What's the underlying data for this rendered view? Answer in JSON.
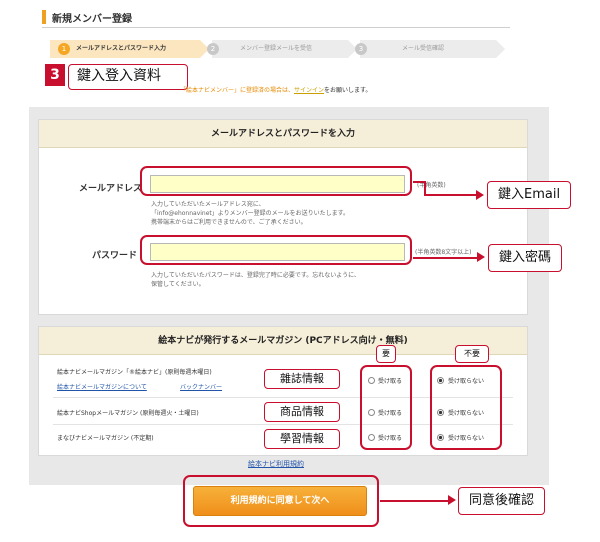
{
  "page": {
    "section_title": "新規メンバー登録"
  },
  "steps": [
    {
      "num": "1",
      "label": "メールアドレスとパスワード入力"
    },
    {
      "num": "2",
      "label": "メンバー登録メールを受信"
    },
    {
      "num": "3",
      "label": "メール受信確認"
    }
  ],
  "annotations": {
    "step_tag": "3",
    "login_title": "鍵入登入資料",
    "email_callout": "鍵入Email",
    "password_callout": "鍵入密碼",
    "magazine_tag": "雜誌情報",
    "product_tag": "商品情報",
    "study_tag": "學習情報",
    "subscribe_tag": "要",
    "unsubscribe_tag": "不要",
    "confirm_callout": "同意後確認"
  },
  "notice": {
    "text_pre": "「絵本ナビメンバー」に登録済の場合は、",
    "link": "サインイン",
    "text_post": "をお願いします。"
  },
  "credentials": {
    "heading": "メールアドレスとパスワードを入力",
    "email": {
      "label": "メールアドレス",
      "value": "",
      "hint": "(半角英数)",
      "note_lines": [
        "入力していただいたメールアドレス宛に、",
        "「info@ehonnavinet」よりメンバー登録のメールをお送りいたします。",
        "携帯端末からはご利用できませんので、ご了承ください。"
      ]
    },
    "password": {
      "label": "パスワード",
      "value": "",
      "hint": "(半角英数8文字以上)",
      "note_lines": [
        "入力していただいたパスワードは、登録完了時に必要です。忘れないように、",
        "保管してください。"
      ]
    }
  },
  "magazines": {
    "heading": "絵本ナビが発行するメールマガジン (PCアドレス向け・無料)",
    "rows": [
      {
        "name": "絵本ナビメールマガジン「®絵本ナビ」(原則毎週木曜日)",
        "links": [
          "絵本ナビメールマガジンについて",
          "バックナンバー"
        ],
        "yes_label": "受け取る",
        "no_label": "受け取らない",
        "selected": "no"
      },
      {
        "name": "絵本ナビShopメールマガジン (原則毎週火・土曜日)",
        "links": [],
        "yes_label": "受け取る",
        "no_label": "受け取らない",
        "selected": "no"
      },
      {
        "name": "まなびナビメールマガジン (不定期)",
        "links": [],
        "yes_label": "受け取る",
        "no_label": "受け取らない",
        "selected": "no"
      }
    ]
  },
  "footer": {
    "terms_link": "絵本ナビ利用規約",
    "next_button": "利用規約に同意して次へ"
  },
  "colors": {
    "accent": "#f5a623",
    "annotation_red": "#c8102e",
    "input_bg": "#ffffc8",
    "panel_bg": "#e8e8e8",
    "heading_bg": "#f5eed8"
  }
}
